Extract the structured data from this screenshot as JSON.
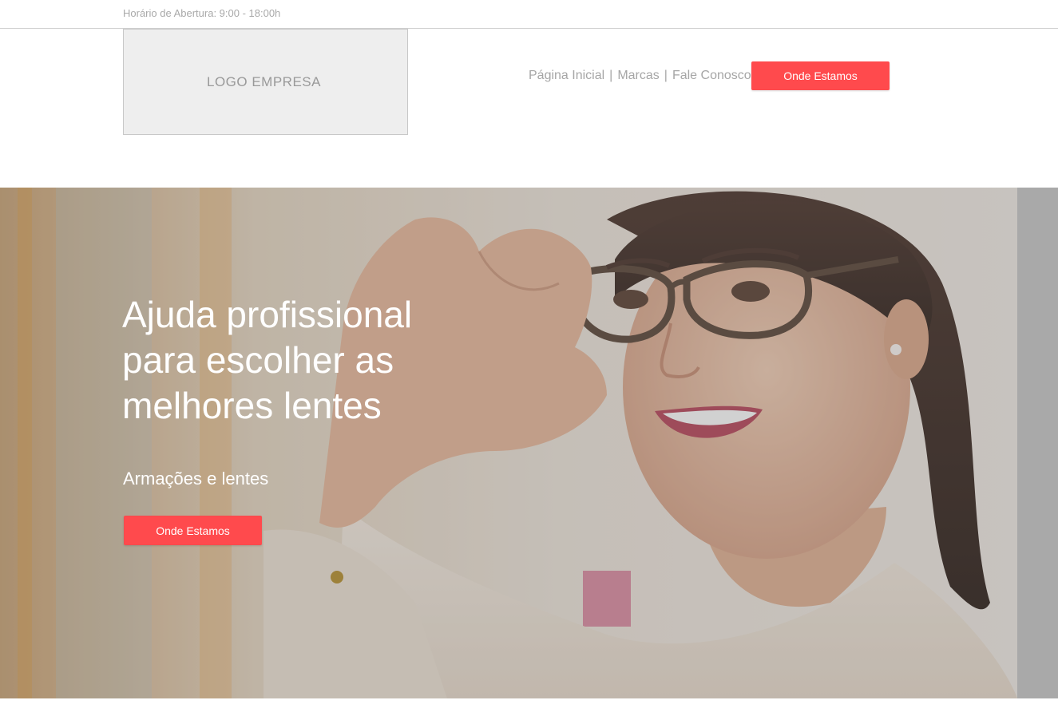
{
  "topbar": {
    "hours": "Horário de Abertura: 9:00 - 18:00h"
  },
  "header": {
    "logo_text": "LOGO EMPRESA",
    "nav": [
      {
        "label": "Página Inicial"
      },
      {
        "label": "Marcas"
      },
      {
        "label": "Fale Conosco"
      }
    ],
    "nav_separator": "|",
    "cta_label": "Onde Estamos"
  },
  "hero": {
    "title": "Ajuda profissional para escolher as melhores lentes",
    "subtitle": "Armações e lentes",
    "cta_label": "Onde Estamos",
    "image": "woman-with-glasses-photo"
  },
  "colors": {
    "accent": "#ff4a4d",
    "muted_text": "#a6a6a6",
    "logo_bg": "#eeeeee"
  }
}
